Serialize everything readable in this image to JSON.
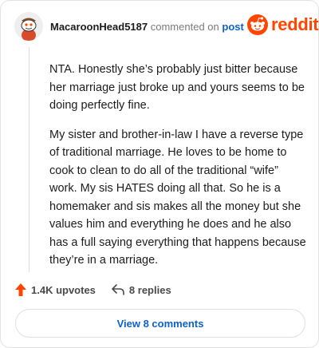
{
  "comment": {
    "username": "MacaroonHead5187",
    "action_text": "commented on",
    "post_link": "post",
    "paragraphs": [
      "NTA. Honestly she’s probably just bitter because her marriage just broke up and yours seems to be doing perfectly fine.",
      "My sister and brother-in-law I have a reverse type of traditional marriage. He loves to be home to cook to clean to do all of the traditional “wife” work. My sis HATES doing all that. So he is a homemaker and sis makes all the money but she values him and everything he does and he also has a full saying everything that happens because they’re in a marriage."
    ]
  },
  "brand": {
    "logo_text": "reddit",
    "accent_color": "#ff4500"
  },
  "actions": {
    "upvotes": "1.4K upvotes",
    "replies": "8 replies",
    "view_comments": "View 8 comments"
  },
  "colors": {
    "link": "#0b62c9",
    "upvote": "#ff4500",
    "border": "#e3e3e3"
  }
}
